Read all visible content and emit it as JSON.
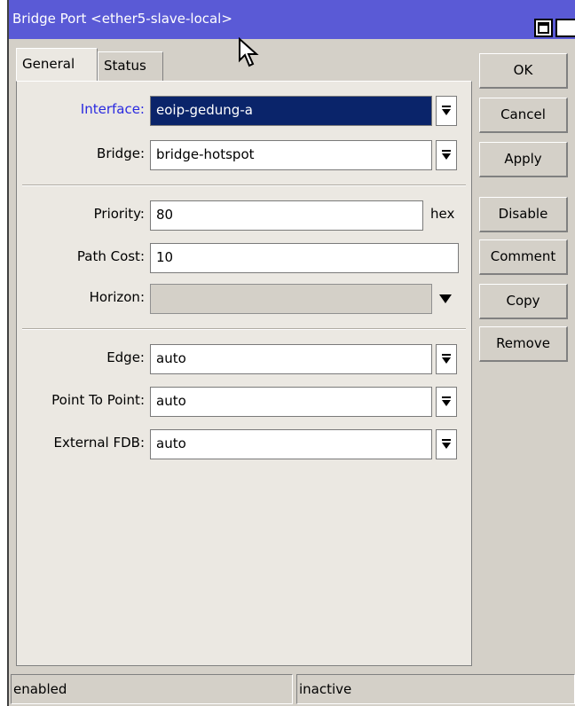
{
  "window": {
    "title": "Bridge Port <ether5-slave-local>"
  },
  "tabs": [
    {
      "label": "General",
      "active": true
    },
    {
      "label": "Status",
      "active": false
    }
  ],
  "form": {
    "interface": {
      "label": "Interface:",
      "value": "eoip-gedung-a"
    },
    "bridge": {
      "label": "Bridge:",
      "value": "bridge-hotspot"
    },
    "priority": {
      "label": "Priority:",
      "value": "80",
      "unit": "hex"
    },
    "path_cost": {
      "label": "Path Cost:",
      "value": "10"
    },
    "horizon": {
      "label": "Horizon:",
      "value": ""
    },
    "edge": {
      "label": "Edge:",
      "value": "auto"
    },
    "point_to_point": {
      "label": "Point To Point:",
      "value": "auto"
    },
    "external_fdb": {
      "label": "External FDB:",
      "value": "auto"
    }
  },
  "buttons": {
    "ok": "OK",
    "cancel": "Cancel",
    "apply": "Apply",
    "disable": "Disable",
    "comment": "Comment",
    "copy": "Copy",
    "remove": "Remove"
  },
  "status": {
    "left": "enabled",
    "right": "inactive"
  },
  "colors": {
    "titlebar": "#5a5ad6",
    "selection": "#0a246a",
    "interface_label": "#2a2ae0"
  },
  "icons": [
    "maximize-icon",
    "close-icon",
    "dropdown-arrow-icon",
    "cursor-icon"
  ]
}
